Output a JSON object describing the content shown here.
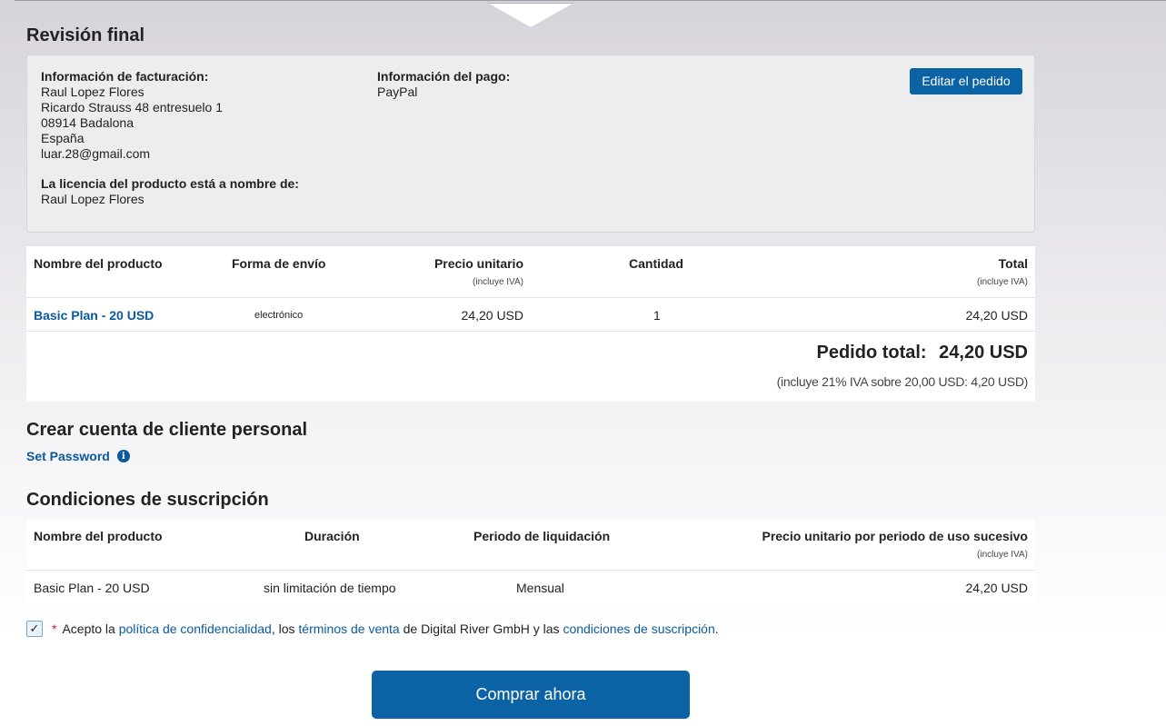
{
  "review": {
    "title": "Revisión final",
    "billing": {
      "label": "Información de facturación:",
      "name": "Raul Lopez Flores",
      "street": "Ricardo Strauss 48 entresuelo 1",
      "city": "08914 Badalona",
      "country": "España",
      "email": "luar.28@gmail.com"
    },
    "license": {
      "label": "La licencia del producto está a nombre de:",
      "name": "Raul Lopez Flores"
    },
    "payment": {
      "label": "Información del pago:",
      "method": "PayPal"
    },
    "edit_button": "Editar el pedido"
  },
  "order_table": {
    "headers": {
      "product": "Nombre del producto",
      "shipping": "Forma de envío",
      "unit_price": "Precio unitario",
      "unit_price_note": "(incluye IVA)",
      "quantity": "Cantidad",
      "total": "Total",
      "total_note": "(incluye IVA)"
    },
    "rows": [
      {
        "product": "Basic Plan - 20 USD",
        "shipping": "electrónico",
        "unit_price": "24,20 USD",
        "quantity": "1",
        "total": "24,20 USD"
      }
    ],
    "order_total_label": "Pedido total:",
    "order_total_value": "24,20 USD",
    "vat_note": "(incluye 21% IVA sobre 20,00 USD: 4,20 USD)"
  },
  "account": {
    "title": "Crear cuenta de cliente personal",
    "set_password": "Set Password",
    "info_icon": "i"
  },
  "subscription": {
    "title": "Condiciones de suscripción",
    "headers": {
      "product": "Nombre del producto",
      "duration": "Duración",
      "billing_period": "Periodo de liquidación",
      "unit_price": "Precio unitario por periodo de uso sucesivo",
      "unit_price_note": "(incluye IVA)"
    },
    "rows": [
      {
        "product": "Basic Plan - 20 USD",
        "duration": "sin limitación de tiempo",
        "billing_period": "Mensual",
        "unit_price": "24,20 USD"
      }
    ]
  },
  "consent": {
    "checked": true,
    "check_glyph": "✓",
    "required_mark": "*",
    "text_1": "Acepto la ",
    "link_privacy": "política de confidencialidad",
    "text_2": ", los ",
    "link_terms": "términos de venta",
    "text_3": " de Digital River GmbH y las ",
    "link_conditions": "condiciones de suscripción",
    "text_4": "."
  },
  "buy_button": "Comprar ahora",
  "colors": {
    "accent": "#0b62a4",
    "link": "#0b5aa0",
    "required": "#c0262d"
  }
}
